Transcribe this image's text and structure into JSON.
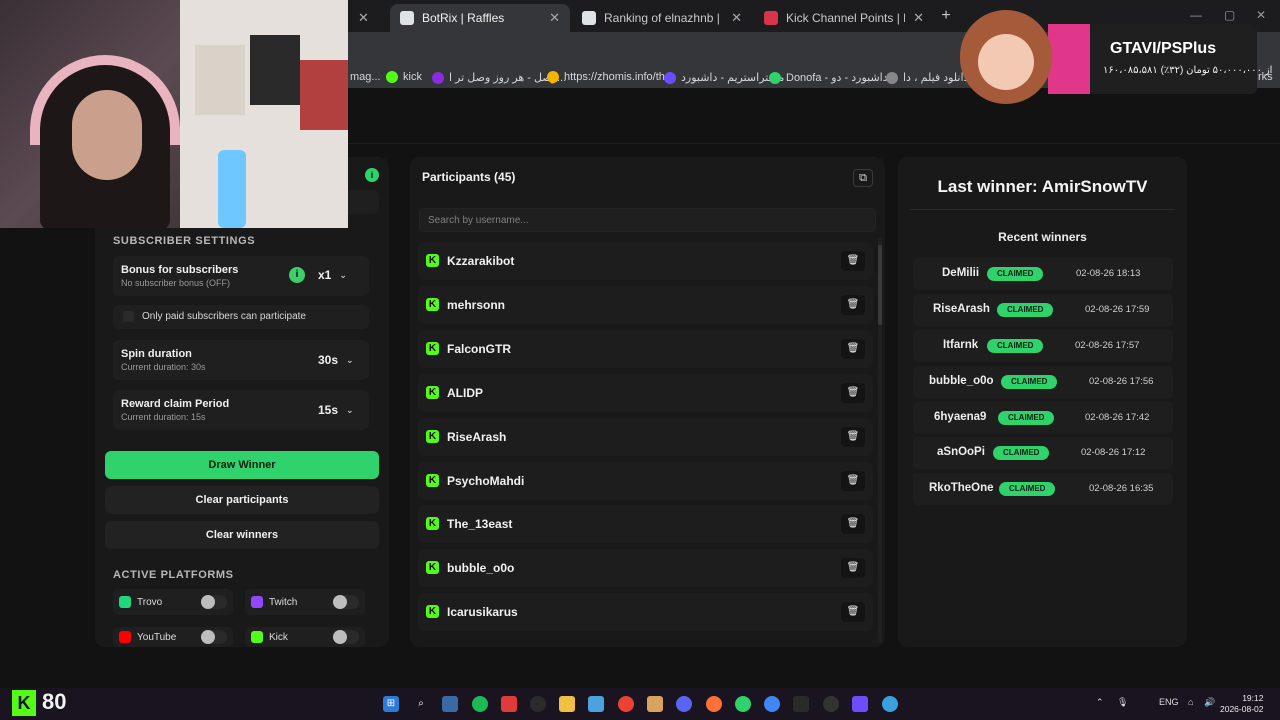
{
  "browser": {
    "tabs": [
      {
        "title": "",
        "active": false
      },
      {
        "title": "BotRix | Raffles",
        "active": true
      },
      {
        "title": "Ranking of elnazhnb | BotRix — C",
        "active": false
      },
      {
        "title": "Kick Channel Points | Blerp",
        "active": false
      }
    ],
    "new_tab": "+",
    "bookmarks": [
      "mag...",
      "kick",
      "وصل - هر روز وصل تر ا...",
      "https://zhomis.info/th...",
      "مستراستریم - داشبورد",
      "Donofa - داشبورد - دو...",
      "دانلود فیلم ، دا...",
      "rks"
    ]
  },
  "settings": {
    "section_title": "SUBSCRIBER SETTINGS",
    "bonus": {
      "title": "Bonus for subscribers",
      "subtitle": "No subscriber bonus (OFF)",
      "value": "x1"
    },
    "paid_only": {
      "label": "Only paid subscribers can participate",
      "checked": false
    },
    "spin": {
      "title": "Spin duration",
      "subtitle": "Current duration: 30s",
      "value": "30s"
    },
    "claim": {
      "title": "Reward claim Period",
      "subtitle": "Current duration: 15s",
      "value": "15s"
    },
    "draw_label": "Draw Winner",
    "clear_participants_label": "Clear participants",
    "clear_winners_label": "Clear winners",
    "platforms_title": "ACTIVE PLATFORMS",
    "platforms": [
      {
        "name": "Trovo",
        "color": "#1fd87c"
      },
      {
        "name": "Twitch",
        "color": "#9146ff"
      },
      {
        "name": "YouTube",
        "color": "#ff0000"
      },
      {
        "name": "Kick",
        "color": "#53fc18"
      }
    ]
  },
  "participants": {
    "title": "Participants (45)",
    "search_placeholder": "Search by username...",
    "items": [
      "Kzzarakibot",
      "mehrsonn",
      "FalconGTR",
      "ALIDP",
      "RiseArash",
      "PsychoMahdi",
      "The_13east",
      "bubble_o0o",
      "Icarusikarus"
    ]
  },
  "winners": {
    "last_winner": "Last winner: AmirSnowTV",
    "recent_title": "Recent winners",
    "claimed_label": "CLAIMED",
    "items": [
      {
        "name": "DeMilii",
        "date": "02-08-26 18:13"
      },
      {
        "name": "RiseArash",
        "date": "02-08-26 17:59"
      },
      {
        "name": "Itfarnk",
        "date": "02-08-26 17:57"
      },
      {
        "name": "bubble_o0o",
        "date": "02-08-26 17:56"
      },
      {
        "name": "6hyaena9",
        "date": "02-08-26 17:42"
      },
      {
        "name": "aSnOoPi",
        "date": "02-08-26 17:12"
      },
      {
        "name": "RkoTheOne",
        "date": "02-08-26 16:35"
      }
    ]
  },
  "promo": {
    "title": "GTAVI/PSPlus",
    "subtitle": "۱۶۰،۰۸۵،۵۸۱ از ۵۰،۰۰۰،۰۰۰ تومان (۳۲٪)"
  },
  "taskbar": {
    "kick_text": "80",
    "lang": "ENG",
    "time": "19:12",
    "date": "2026-08-02"
  },
  "colors": {
    "accent_green": "#2fd26b",
    "kick_green": "#53fc18"
  }
}
